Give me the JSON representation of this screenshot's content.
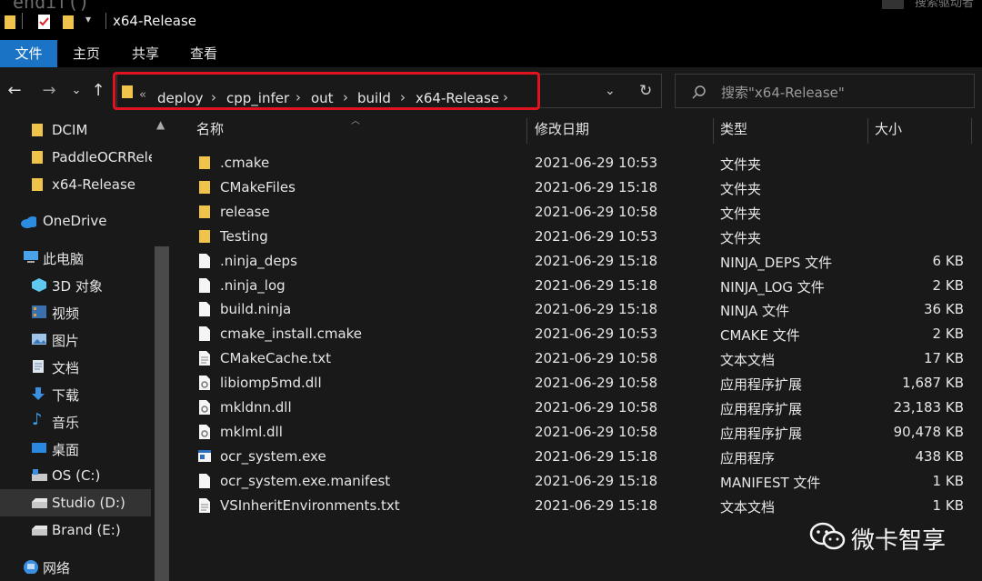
{
  "titlebar": {
    "background_code": "endif()",
    "window_title": "x64-Release",
    "right_partial_text": "搜索驱动者"
  },
  "ribbon": {
    "tabs": [
      {
        "label": "文件",
        "active": true
      },
      {
        "label": "主页",
        "active": false
      },
      {
        "label": "共享",
        "active": false
      },
      {
        "label": "查看",
        "active": false
      }
    ]
  },
  "address": {
    "overflow_marker": "«",
    "crumbs": [
      "deploy",
      "cpp_infer",
      "out",
      "build",
      "x64-Release"
    ],
    "separator": "›"
  },
  "search": {
    "placeholder": "搜索\"x64-Release\""
  },
  "sidebar": {
    "items": [
      {
        "label": "DCIM",
        "icon": "folder-icon"
      },
      {
        "label": "PaddleOCRRele",
        "icon": "folder-icon"
      },
      {
        "label": "x64-Release",
        "icon": "folder-icon"
      },
      {
        "label": "OneDrive",
        "icon": "cloud-icon"
      },
      {
        "label": "此电脑",
        "icon": "computer-icon"
      },
      {
        "label": "3D 对象",
        "icon": "3d-objects-icon"
      },
      {
        "label": "视频",
        "icon": "video-icon"
      },
      {
        "label": "图片",
        "icon": "pictures-icon"
      },
      {
        "label": "文档",
        "icon": "documents-icon"
      },
      {
        "label": "下载",
        "icon": "download-icon"
      },
      {
        "label": "音乐",
        "icon": "music-icon"
      },
      {
        "label": "桌面",
        "icon": "desktop-icon"
      },
      {
        "label": "OS (C:)",
        "icon": "drive-icon"
      },
      {
        "label": "Studio (D:)",
        "icon": "drive-icon",
        "selected": true
      },
      {
        "label": "Brand (E:)",
        "icon": "drive-icon"
      },
      {
        "label": "网络",
        "icon": "network-icon"
      }
    ]
  },
  "columns": {
    "name": "名称",
    "modified": "修改日期",
    "type": "类型",
    "size": "大小"
  },
  "files": [
    {
      "name": ".cmake",
      "modified": "2021-06-29 10:53",
      "type": "文件夹",
      "size": "",
      "icon": "folder-icon"
    },
    {
      "name": "CMakeFiles",
      "modified": "2021-06-29 15:18",
      "type": "文件夹",
      "size": "",
      "icon": "folder-icon"
    },
    {
      "name": "release",
      "modified": "2021-06-29 10:58",
      "type": "文件夹",
      "size": "",
      "icon": "folder-icon"
    },
    {
      "name": "Testing",
      "modified": "2021-06-29 10:53",
      "type": "文件夹",
      "size": "",
      "icon": "folder-icon"
    },
    {
      "name": ".ninja_deps",
      "modified": "2021-06-29 15:18",
      "type": "NINJA_DEPS 文件",
      "size": "6 KB",
      "icon": "file-icon"
    },
    {
      "name": ".ninja_log",
      "modified": "2021-06-29 15:18",
      "type": "NINJA_LOG 文件",
      "size": "2 KB",
      "icon": "file-icon"
    },
    {
      "name": "build.ninja",
      "modified": "2021-06-29 15:18",
      "type": "NINJA 文件",
      "size": "36 KB",
      "icon": "file-icon"
    },
    {
      "name": "cmake_install.cmake",
      "modified": "2021-06-29 10:53",
      "type": "CMAKE 文件",
      "size": "2 KB",
      "icon": "file-icon"
    },
    {
      "name": "CMakeCache.txt",
      "modified": "2021-06-29 10:58",
      "type": "文本文档",
      "size": "17 KB",
      "icon": "text-file-icon"
    },
    {
      "name": "libiomp5md.dll",
      "modified": "2021-06-29 10:58",
      "type": "应用程序扩展",
      "size": "1,687 KB",
      "icon": "dll-icon"
    },
    {
      "name": "mkldnn.dll",
      "modified": "2021-06-29 10:58",
      "type": "应用程序扩展",
      "size": "23,183 KB",
      "icon": "dll-icon"
    },
    {
      "name": "mklml.dll",
      "modified": "2021-06-29 10:58",
      "type": "应用程序扩展",
      "size": "90,478 KB",
      "icon": "dll-icon"
    },
    {
      "name": "ocr_system.exe",
      "modified": "2021-06-29 15:18",
      "type": "应用程序",
      "size": "438 KB",
      "icon": "exe-icon"
    },
    {
      "name": "ocr_system.exe.manifest",
      "modified": "2021-06-29 15:18",
      "type": "MANIFEST 文件",
      "size": "1 KB",
      "icon": "file-icon"
    },
    {
      "name": "VSInheritEnvironments.txt",
      "modified": "2021-06-29 15:18",
      "type": "文本文档",
      "size": "1 KB",
      "icon": "text-file-icon"
    }
  ],
  "watermark": {
    "text": "微卡智享",
    "icon": "wechat-icon"
  },
  "colors": {
    "accent": "#1a73c4",
    "highlight": "#e0141e",
    "folder": "#f0c34a",
    "background": "#191919"
  }
}
